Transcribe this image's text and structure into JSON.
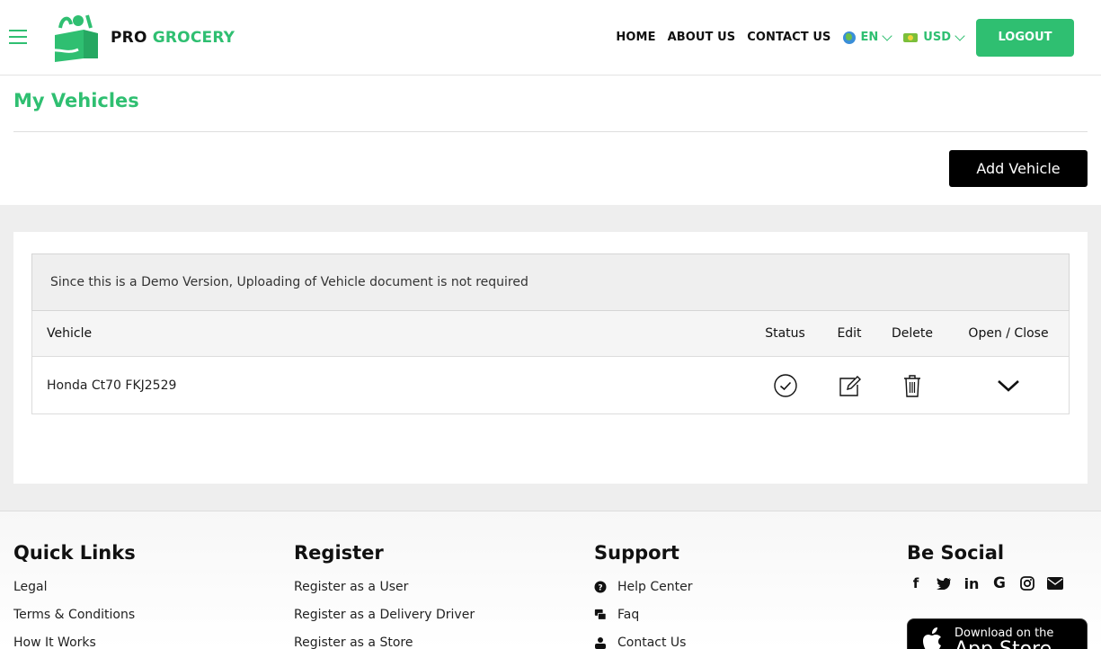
{
  "header": {
    "logo": {
      "pro": "PRO",
      "grocery": "GROCERY"
    },
    "nav": {
      "home": "HOME",
      "about": "ABOUT US",
      "contact": "CONTACT US"
    },
    "language": "EN",
    "currency": "USD",
    "logout_label": "LOGOUT"
  },
  "page": {
    "title": "My Vehicles",
    "add_label": "Add Vehicle",
    "notice": "Since this is a Demo Version, Uploading of Vehicle document is not required"
  },
  "table": {
    "headers": {
      "vehicle": "Vehicle",
      "status": "Status",
      "edit": "Edit",
      "delete": "Delete",
      "open": "Open / Close"
    },
    "rows": [
      {
        "vehicle": "Honda Ct70 FKJ2529"
      }
    ]
  },
  "footer": {
    "quick_links": {
      "title": "Quick Links",
      "items": [
        "Legal",
        "Terms & Conditions",
        "How It Works"
      ]
    },
    "register": {
      "title": "Register",
      "items": [
        "Register as a User",
        "Register as a Delivery Driver",
        "Register as a Store"
      ]
    },
    "support": {
      "title": "Support",
      "items": [
        "Help Center",
        "Faq",
        "Contact Us"
      ]
    },
    "social": {
      "title": "Be Social",
      "icons": [
        "facebook-icon",
        "twitter-icon",
        "linkedin-icon",
        "google-icon",
        "instagram-icon",
        "mail-icon"
      ]
    },
    "appstore": {
      "small": "Download on the",
      "big": "App Store"
    }
  },
  "colors": {
    "brand": "#2fbf71",
    "black": "#000000"
  }
}
